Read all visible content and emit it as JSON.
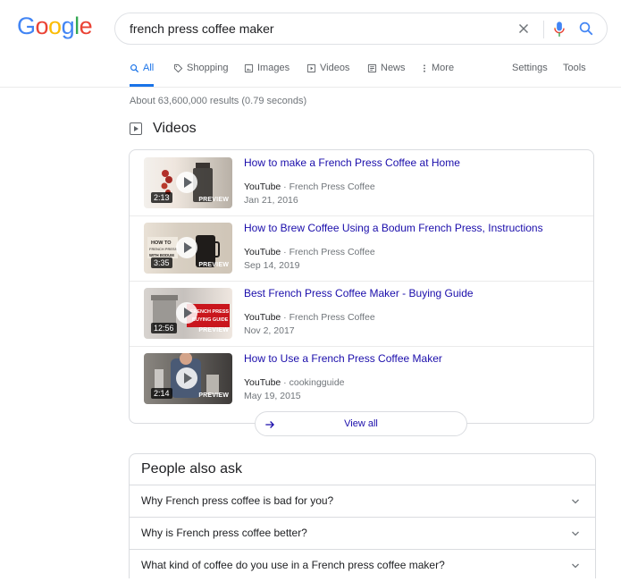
{
  "logo": {
    "letters": [
      "G",
      "o",
      "o",
      "g",
      "l",
      "e"
    ],
    "colors": [
      "#4285F4",
      "#EA4335",
      "#FBBC05",
      "#4285F4",
      "#34A853",
      "#EA4335"
    ]
  },
  "search": {
    "query": "french press coffee maker"
  },
  "tabs": [
    {
      "label": "All",
      "icon": "search-icon",
      "active": true
    },
    {
      "label": "Shopping",
      "icon": "tag-icon"
    },
    {
      "label": "Images",
      "icon": "image-icon"
    },
    {
      "label": "Videos",
      "icon": "video-icon"
    },
    {
      "label": "News",
      "icon": "news-icon"
    },
    {
      "label": "More",
      "icon": "more-vert-icon"
    },
    {
      "label": "Settings"
    },
    {
      "label": "Tools"
    }
  ],
  "stats": "About 63,600,000 results (0.79 seconds)",
  "videos": {
    "heading": "Videos",
    "items": [
      {
        "title": "How to make a French Press Coffee at Home",
        "platform": "YouTube",
        "separator": " · ",
        "channel": "French Press Coffee",
        "date": "Jan 21, 2016",
        "duration": "2:13",
        "badge": "PREVIEW"
      },
      {
        "title": "How to Brew Coffee Using a Bodum French Press, Instructions",
        "platform": "YouTube",
        "separator": " · ",
        "channel": "French Press Coffee",
        "date": "Sep 14, 2019",
        "duration": "3:35",
        "badge": "PREVIEW"
      },
      {
        "title": "Best French Press Coffee Maker - Buying Guide",
        "platform": "YouTube",
        "separator": " · ",
        "channel": "French Press Coffee",
        "date": "Nov 2, 2017",
        "duration": "12:56",
        "badge": "PREVIEW"
      },
      {
        "title": "How to Use a French Press Coffee Maker",
        "platform": "YouTube",
        "separator": " · ",
        "channel": "cookingguide",
        "date": "May 19, 2015",
        "duration": "2:14",
        "badge": "PREVIEW"
      }
    ],
    "view_all": "View all"
  },
  "people_also_ask": {
    "title": "People also ask",
    "questions": [
      "Why French press coffee is bad for you?",
      "Why is French press coffee better?",
      "What kind of coffee do you use in a French press coffee maker?"
    ]
  },
  "colors": {
    "link": "#1a0dab",
    "accent": "#1a73e8",
    "muted": "#70757a"
  }
}
